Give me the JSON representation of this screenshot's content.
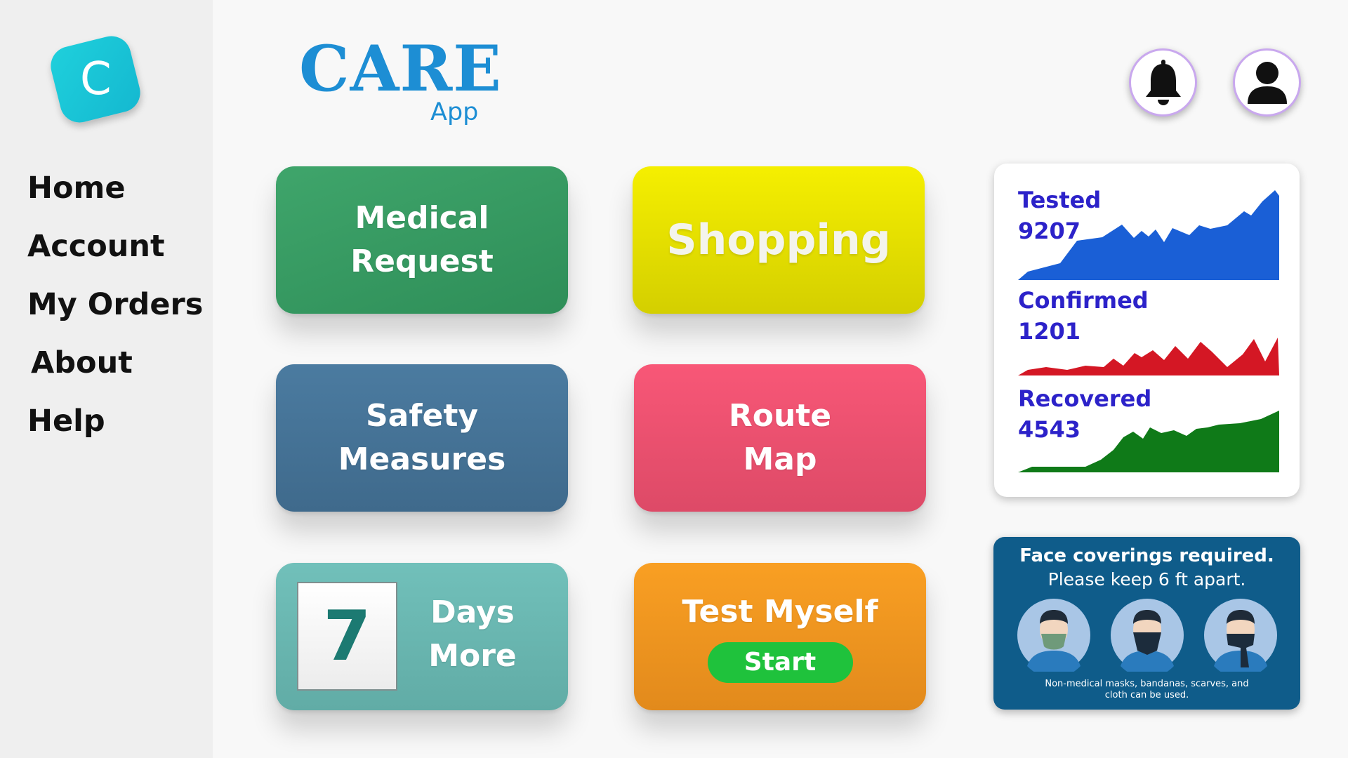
{
  "sidebar": {
    "logo_letter": "C",
    "nav": [
      "Home",
      "Account",
      "My Orders",
      "About",
      "Help"
    ]
  },
  "brand": {
    "title": "CARE",
    "subtitle": "App"
  },
  "header": {
    "notification_icon": "bell-icon",
    "profile_icon": "user-icon"
  },
  "tiles": {
    "medical": {
      "line1": "Medical",
      "line2": "Request"
    },
    "shopping": {
      "label": "Shopping"
    },
    "safety": {
      "line1": "Safety",
      "line2": "Measures"
    },
    "route": {
      "line1": "Route",
      "line2": "Map"
    },
    "days": {
      "number": "7",
      "line1": "Days",
      "line2": "More"
    },
    "test": {
      "label": "Test Myself",
      "button": "Start"
    }
  },
  "stats": [
    {
      "label": "Tested",
      "value": "9207",
      "color": "#1a5fd6"
    },
    {
      "label": "Confirmed",
      "value": "1201",
      "color": "#d41724"
    },
    {
      "label": "Recovered",
      "value": "4543",
      "color": "#0f7a18"
    }
  ],
  "sign": {
    "title": "Face coverings required.",
    "subtitle": "Please keep 6 ft apart.",
    "footnote": "Non-medical masks, bandanas, scarves, and cloth can be used."
  }
}
